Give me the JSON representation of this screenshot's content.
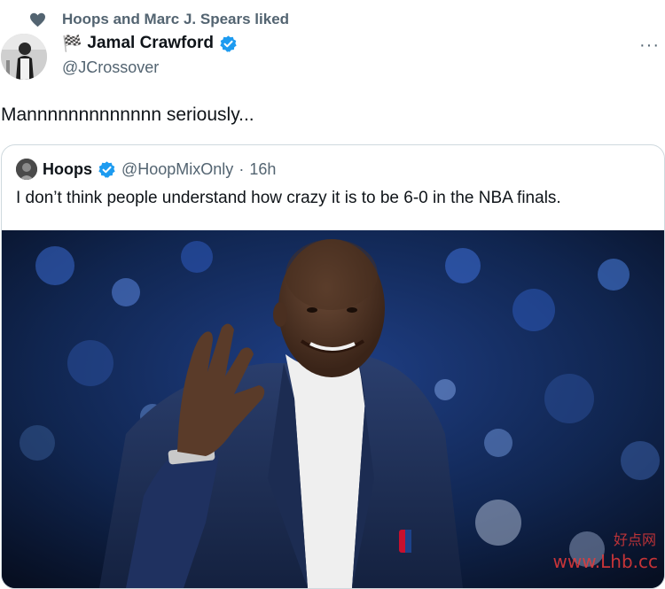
{
  "social_context": {
    "text": "Hoops and Marc J. Spears liked",
    "icon": "heart-icon"
  },
  "tweet": {
    "author_name": "Jamal Crawford",
    "author_handle": "@JCrossover",
    "text": "Mannnnnnnnnnnnn seriously...",
    "more_icon": "···"
  },
  "quoted_tweet": {
    "author_name": "Hoops",
    "author_handle": "@HoopMixOnly",
    "separator": "·",
    "time": "16h",
    "text": "I don’t think people understand how crazy it is to be 6-0 in the NBA finals."
  },
  "watermark": {
    "cn": "好点网",
    "url": "www.Lhb.cc"
  },
  "colors": {
    "verified": "#1d9bf0",
    "muted": "#536471",
    "text": "#0f1419",
    "border": "#cfd9de"
  }
}
